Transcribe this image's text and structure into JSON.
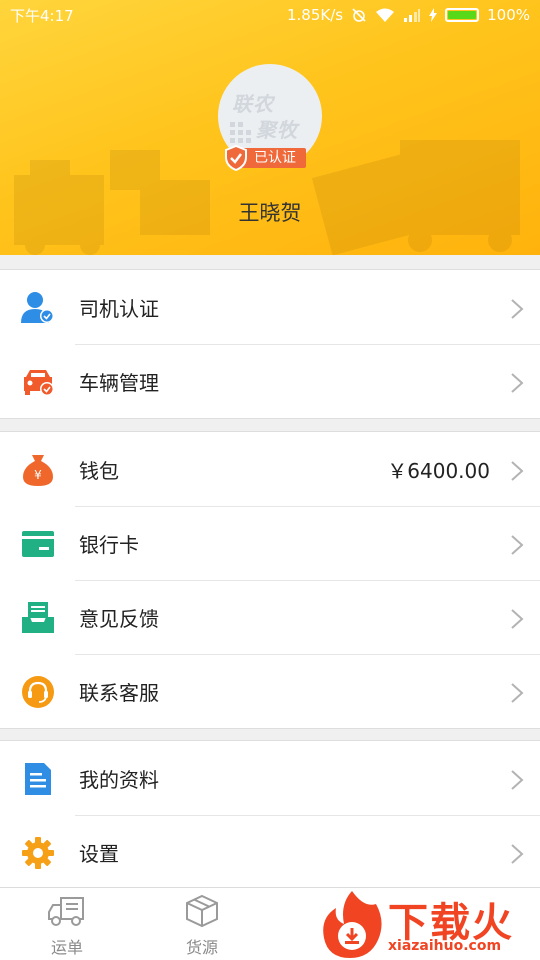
{
  "status_bar": {
    "time": "下午4:17",
    "network_speed": "1.85K/s",
    "battery_percent": "100%"
  },
  "profile": {
    "avatar_text_line1": "联农",
    "avatar_text_line2": "聚牧",
    "verified_label": "已认证",
    "username": "王晓贺"
  },
  "menu_group1": [
    {
      "label": "司机认证",
      "icon": "driver-user-check-icon"
    },
    {
      "label": "车辆管理",
      "icon": "car-check-icon"
    }
  ],
  "menu_group2": [
    {
      "label": "钱包",
      "icon": "money-bag-icon",
      "value": "￥6400.00"
    },
    {
      "label": "银行卡",
      "icon": "bank-card-icon"
    },
    {
      "label": "意见反馈",
      "icon": "feedback-tray-icon"
    },
    {
      "label": "联系客服",
      "icon": "headset-icon"
    }
  ],
  "menu_group3": [
    {
      "label": "我的资料",
      "icon": "document-icon"
    },
    {
      "label": "设置",
      "icon": "gear-icon"
    }
  ],
  "bottom_nav": [
    {
      "label": "运单",
      "icon": "truck-icon"
    },
    {
      "label": "货源",
      "icon": "box-icon"
    }
  ],
  "watermark": {
    "title": "下载火",
    "url": "xiazaihuo.com"
  },
  "colors": {
    "header_yellow": "#ffc41c",
    "verified_orange": "#f0693a",
    "driver_blue": "#2e8de4",
    "car_orange": "#f15a2b",
    "wallet_orange": "#f0672c",
    "card_green": "#21b083",
    "headset_orange": "#f59a12",
    "doc_blue": "#2f8ee4",
    "gear_orange": "#f6a017",
    "watermark_red": "#f04423"
  }
}
